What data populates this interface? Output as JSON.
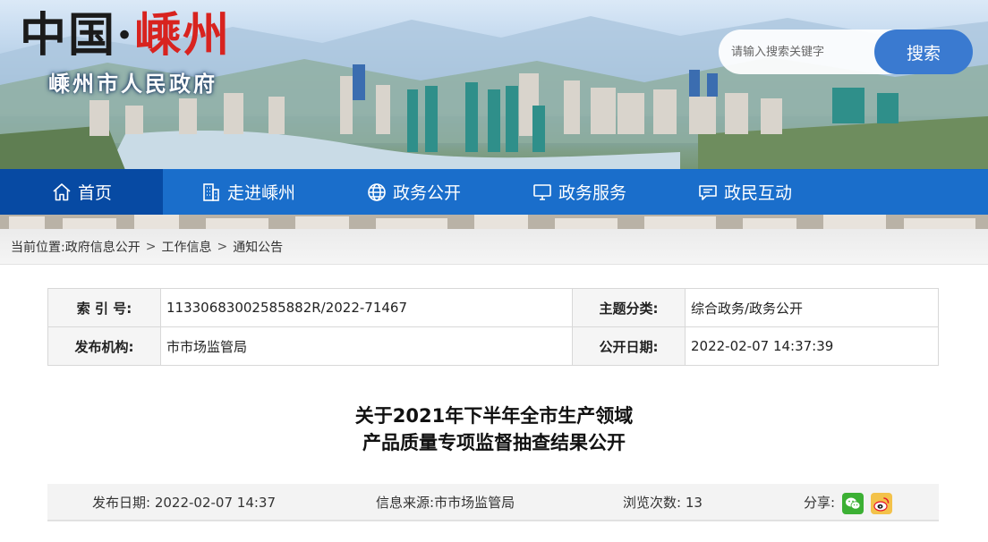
{
  "brand": {
    "title_part1": "中国·",
    "title_part2": "嵊州",
    "subtitle": "嵊州市人民政府"
  },
  "search": {
    "placeholder": "请输入搜索关键字",
    "button_label": "搜索"
  },
  "nav": {
    "items": [
      {
        "label": "首页",
        "icon": "home-icon",
        "active": true
      },
      {
        "label": "走进嵊州",
        "icon": "building-icon"
      },
      {
        "label": "政务公开",
        "icon": "globe-icon"
      },
      {
        "label": "政务服务",
        "icon": "monitor-icon"
      },
      {
        "label": "政民互动",
        "icon": "chat-icon"
      }
    ]
  },
  "breadcrumb": {
    "prefix": "当前位置:",
    "items": [
      "政府信息公开",
      "工作信息",
      "通知公告"
    ],
    "separator": ">"
  },
  "meta": {
    "index_label": "索 引 号:",
    "index_value": "11330683002585882R/2022-71467",
    "topic_label": "主题分类:",
    "topic_value": "综合政务/政务公开",
    "issuer_label": "发布机构:",
    "issuer_value": "市市场监管局",
    "public_date_label": "公开日期:",
    "public_date_value": "2022-02-07 14:37:39"
  },
  "article": {
    "title_line1": "关于2021年下半年全市生产领域",
    "title_line2": "产品质量专项监督抽查结果公开"
  },
  "info": {
    "publish_label": "发布日期:",
    "publish_value": "2022-02-07 14:37",
    "source_label": "信息来源:",
    "source_value": "市市场监管局",
    "views_label": "浏览次数:",
    "views_value": "13",
    "share_label": "分享:"
  },
  "colors": {
    "nav_blue": "#0e68cd",
    "search_blue": "#3a7ad0",
    "brand_red": "#d8231f",
    "wechat_green": "#3cb034",
    "weibo_red": "#e6162d"
  }
}
